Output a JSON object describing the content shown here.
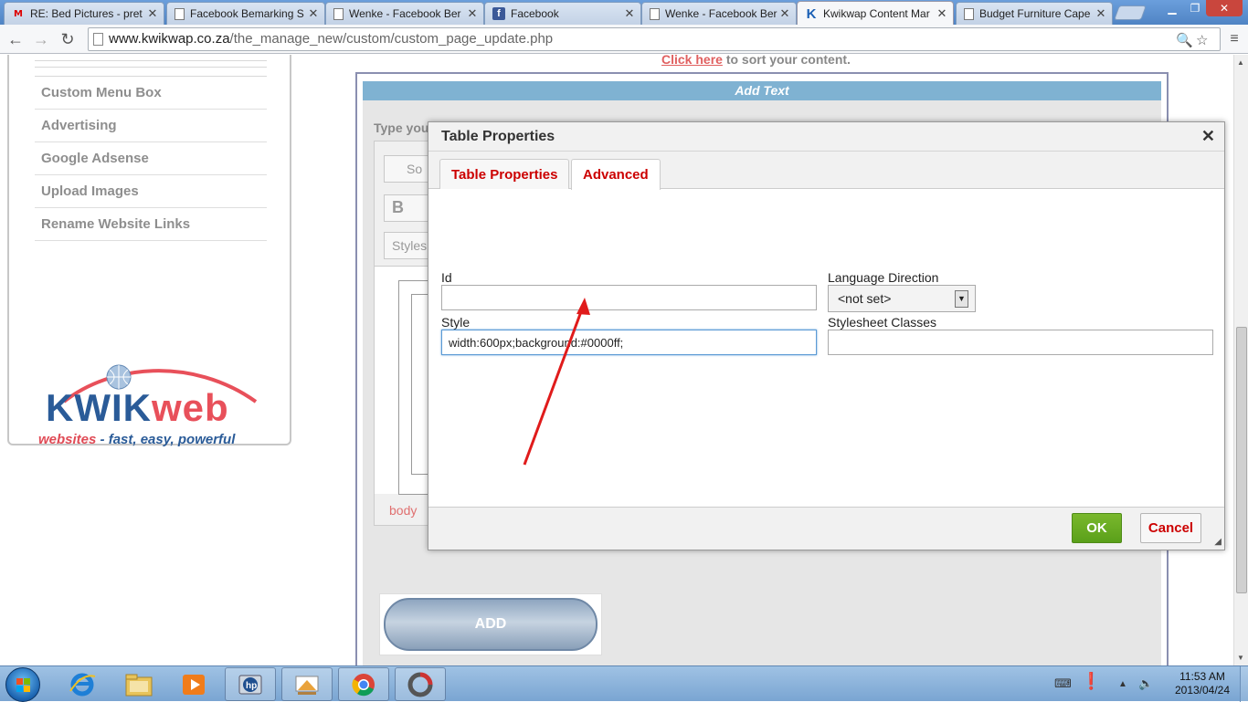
{
  "browser": {
    "tabs": [
      {
        "title": "RE: Bed Pictures - pret",
        "icon": "gmail-icon"
      },
      {
        "title": "Facebook Bemarking S",
        "icon": "document-icon"
      },
      {
        "title": "Wenke - Facebook Ber",
        "icon": "document-icon"
      },
      {
        "title": "Facebook",
        "icon": "facebook-icon"
      },
      {
        "title": "Wenke - Facebook Ber",
        "icon": "document-icon"
      },
      {
        "title": "Kwikwap Content Mar",
        "icon": "kwikwap-icon",
        "active": true
      },
      {
        "title": "Budget Furniture Cape",
        "icon": "document-icon"
      }
    ],
    "url_host": "www.kwikwap.co.za",
    "url_path": "/the_manage_new/custom/custom_page_update.php"
  },
  "sidebar": {
    "items": [
      {
        "label": "Custom Menu Box"
      },
      {
        "label": "Advertising"
      },
      {
        "label": "Google Adsense"
      },
      {
        "label": "Upload Images"
      },
      {
        "label": "Rename Website Links"
      }
    ],
    "logo": {
      "word_a": "KWIK",
      "word_b": "web",
      "tagline_a": "websites",
      "tagline_b": " - fast, easy, powerful"
    }
  },
  "main": {
    "click_here": "Click here",
    "sort_text": " to sort your content.",
    "add_text_header": "Add Text",
    "type_your": "Type you",
    "editor": {
      "source_btn": "So",
      "bold_btn": "B",
      "styles_btn": "Styles",
      "path_label": "body"
    },
    "add_button": "ADD"
  },
  "dialog": {
    "title": "Table Properties",
    "close": "✕",
    "tabs": [
      {
        "label": "Table Properties",
        "active": false
      },
      {
        "label": "Advanced",
        "active": true
      }
    ],
    "fields": {
      "id_label": "Id",
      "id_value": "",
      "lang_label": "Language Direction",
      "lang_value": "<not set>",
      "style_label": "Style",
      "style_value": "width:600px;background:#0000ff;",
      "classes_label": "Stylesheet Classes",
      "classes_value": ""
    },
    "ok": "OK",
    "cancel": "Cancel"
  },
  "annotation": {
    "color": "#e01b1b"
  },
  "taskbar": {
    "time": "11:53 AM",
    "date": "2013/04/24"
  },
  "colors": {
    "accent_blue_bar": "#7fb2d2",
    "ok_green": "#5aa01a",
    "tab_red": "#cc0000"
  }
}
